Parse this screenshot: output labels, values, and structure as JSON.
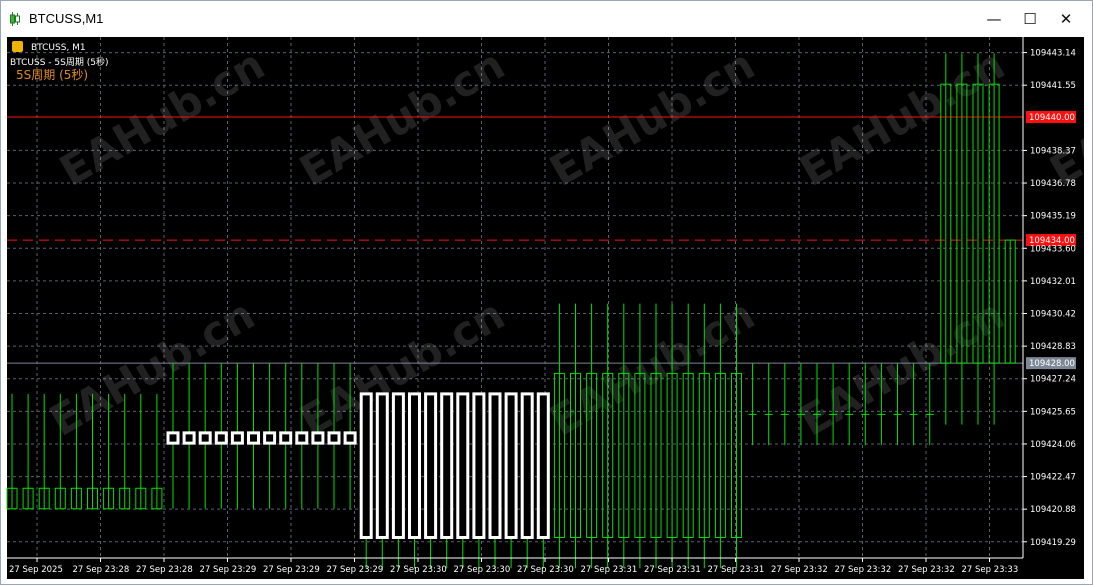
{
  "window": {
    "title": "BTCUSS,M1",
    "controls": {
      "minimize": "—",
      "maximize": "☐",
      "close": "✕"
    }
  },
  "chart_header": {
    "symbol_line": "BTCUSS, M1",
    "indicator_line": "BTCUSS - 5S周期 (5秒)",
    "overlay_label": "5S周期 (5秒)"
  },
  "watermark": "EAHub.cn",
  "colors": {
    "background": "#000000",
    "grid": "#5a6070",
    "candle": "#00e000",
    "candle_bold": "#ffffff",
    "red_line": "#ff1010",
    "price_line": "#7d8796",
    "accent_label": "#e08a1e"
  },
  "chart_data": {
    "type": "candlestick",
    "y_axis": {
      "min": 109418.5,
      "max": 109443.9,
      "ticks": [
        "109443.14",
        "109441.55",
        "109438.37",
        "109436.78",
        "109435.19",
        "109433.60",
        "109432.01",
        "109430.42",
        "109428.83",
        "109427.24",
        "109425.65",
        "109424.06",
        "109422.47",
        "109420.88",
        "109419.29"
      ]
    },
    "x_axis": {
      "labels": [
        "27 Sep 2025",
        "27 Sep 23:28",
        "27 Sep 23:28",
        "27 Sep 23:29",
        "27 Sep 23:29",
        "27 Sep 23:29",
        "27 Sep 23:30",
        "27 Sep 23:30",
        "27 Sep 23:30",
        "27 Sep 23:31",
        "27 Sep 23:31",
        "27 Sep 23:31",
        "27 Sep 23:32",
        "27 Sep 23:32",
        "27 Sep 23:32",
        "27 Sep 23:33"
      ]
    },
    "levels": [
      {
        "name": "red-level",
        "value": 109440.0,
        "label": "109440.00",
        "style": "solid",
        "color": "#ff1010"
      },
      {
        "name": "red-dashed-level",
        "value": 109434.0,
        "label": "109434.00",
        "style": "dashed",
        "color": "#ff1010"
      },
      {
        "name": "current-price",
        "value": 109428.0,
        "label": "109428.00",
        "style": "solid",
        "color": "#7d8796"
      }
    ],
    "candle_groups": [
      {
        "count": 10,
        "open": 109421.9,
        "close": 109420.9,
        "high": 109426.5,
        "low": 109420.9,
        "bold": false,
        "wick_only": false
      },
      {
        "count": 12,
        "open": 109424.6,
        "close": 109424.1,
        "high": 109428.0,
        "low": 109420.9,
        "bold": true,
        "wick_only": false
      },
      {
        "count": 12,
        "open": 109426.5,
        "close": 109419.5,
        "high": 109426.5,
        "low": 109418.0,
        "bold": true,
        "wick_only": false
      },
      {
        "count": 12,
        "open": 109427.5,
        "close": 109419.5,
        "high": 109430.9,
        "low": 109418.0,
        "bold": false,
        "wick_only": false
      },
      {
        "count": 12,
        "open": 109425.5,
        "close": 109425.5,
        "high": 109428.0,
        "low": 109424.0,
        "bold": false,
        "wick_only": true
      },
      {
        "count": 4,
        "open": 109441.6,
        "close": 109428.0,
        "high": 109443.1,
        "low": 109425.0,
        "bold": false,
        "wick_only": false
      },
      {
        "count": 1,
        "open": 109434.0,
        "close": 109428.0,
        "high": 109434.0,
        "low": 109428.0,
        "bold": false,
        "wick_only": false
      }
    ]
  }
}
